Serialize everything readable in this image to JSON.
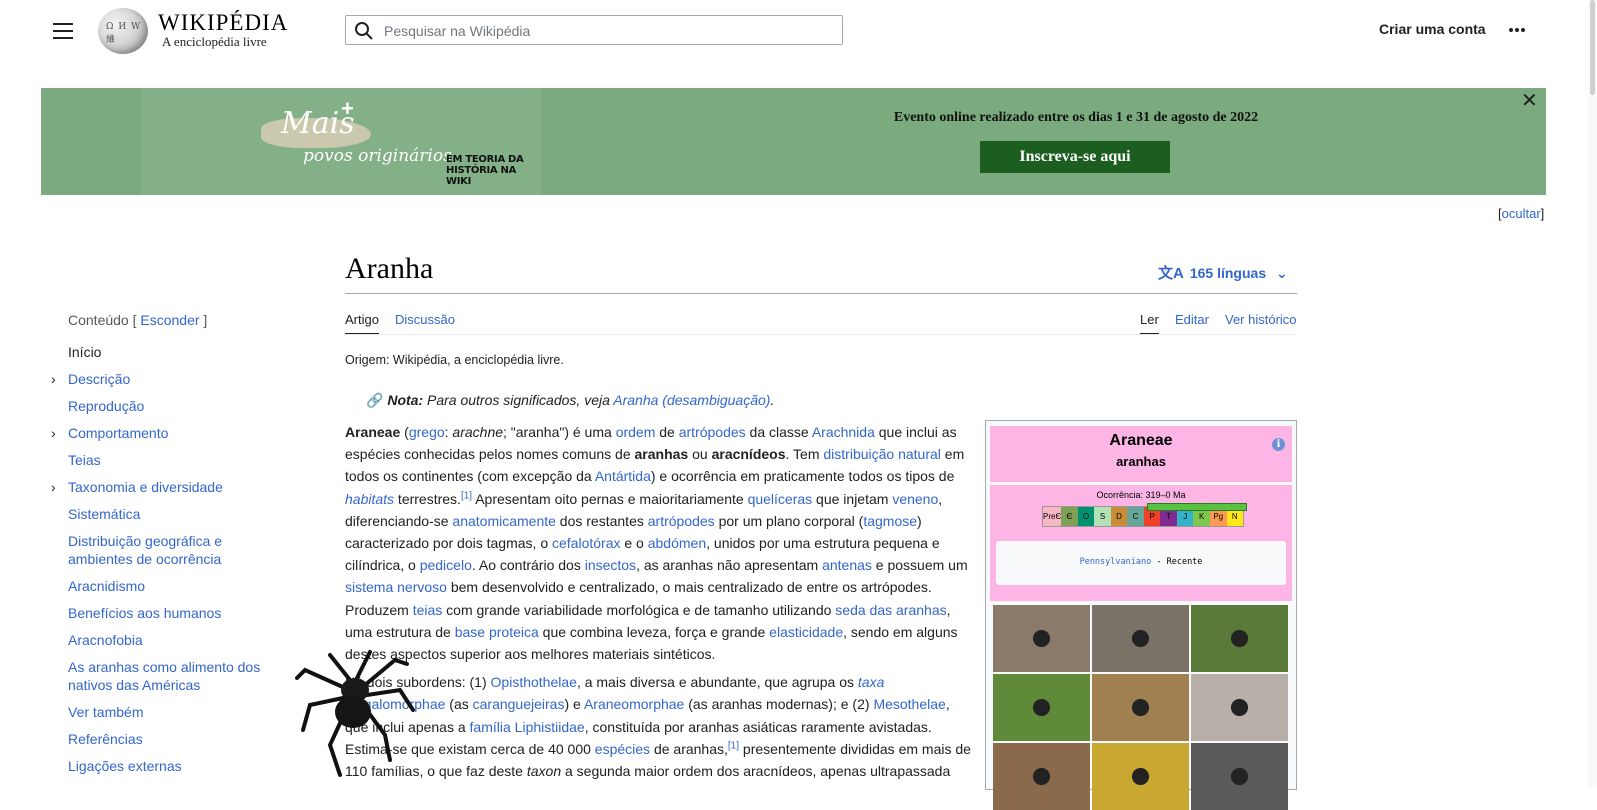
{
  "header": {
    "menu_icon": "hamburger-menu-icon",
    "logo_icon": "wikipedia-globe-logo",
    "wordmark": "WIKIPÉDIA",
    "tagline": "A enciclopédia livre",
    "search_placeholder": "Pesquisar na Wikipédia",
    "create_account": "Criar uma conta",
    "more_icon": "ellipsis-icon"
  },
  "banner": {
    "logo_mais": "Mais",
    "logo_plus": "+",
    "logo_povos": "povos originários",
    "logo_em_teoria": "EM TEORIA DA HISTÓRIA NA WIKI",
    "event_text": "Evento online realizado entre os dias 1 e 31 de agosto de 2022",
    "subscribe_label": "Inscreva-se aqui",
    "close_label": "✕",
    "hide_label": "[ocultar]",
    "background_color": "#7aaa7e",
    "button_color": "#1b5e20"
  },
  "toc": {
    "title": "Conteúdo",
    "toggle": "Esconder",
    "items": [
      {
        "label": "Início",
        "expandable": false
      },
      {
        "label": "Descrição",
        "expandable": true
      },
      {
        "label": "Reprodução",
        "expandable": false
      },
      {
        "label": "Comportamento",
        "expandable": true
      },
      {
        "label": "Teias",
        "expandable": false
      },
      {
        "label": "Taxonomia e diversidade",
        "expandable": true
      },
      {
        "label": "Sistemática",
        "expandable": false
      },
      {
        "label": "Distribuição geográfica e ambientes de ocorrência",
        "expandable": false
      },
      {
        "label": "Aracnidismo",
        "expandable": false
      },
      {
        "label": "Benefícios aos humanos",
        "expandable": false
      },
      {
        "label": "Aracnofobia",
        "expandable": false
      },
      {
        "label": "As aranhas como alimento dos nativos das Américas",
        "expandable": false
      },
      {
        "label": "Ver também",
        "expandable": false
      },
      {
        "label": "Referências",
        "expandable": false
      },
      {
        "label": "Ligações externas",
        "expandable": false
      }
    ]
  },
  "article": {
    "title": "Aranha",
    "languages": "165 línguas",
    "tabs": {
      "article": "Artigo",
      "talk": "Discussão",
      "read": "Ler",
      "edit": "Editar",
      "history": "Ver histórico"
    },
    "origin": "Origem: Wikipédia, a enciclopédia livre.",
    "hatnote_label": "Nota:",
    "hatnote_text": "Para outros significados, veja",
    "hatnote_link": "Aranha (desambiguação)",
    "hatnote_end": "."
  },
  "infobox": {
    "name": "Araneae",
    "common_name": "aranhas",
    "info_icon": "i",
    "occurrence": "Ocorrência: 319–0 Ma",
    "periods": [
      "PreЄ",
      "Є",
      "O",
      "S",
      "D",
      "C",
      "P",
      "T",
      "J",
      "K",
      "Pg",
      "N"
    ],
    "period_colors": [
      "#f7b6c2",
      "#7fa056",
      "#009270",
      "#b3e1b6",
      "#cb8c37",
      "#67a599",
      "#f04028",
      "#812b92",
      "#34b2c9",
      "#7fc64e",
      "#fd9a52",
      "#ffe619"
    ],
    "range_from": "Pennsylvaniano",
    "range_sep": " - ",
    "range_to": "Recente",
    "header_color": "#fcb5e5",
    "gallery_colors": [
      "#8a7a6a",
      "#7a7266",
      "#5a7a3a",
      "#5e8a3a",
      "#a08050",
      "#b8b0a8",
      "#8a6a4a",
      "#c8a830",
      "#5a5a5a"
    ]
  }
}
